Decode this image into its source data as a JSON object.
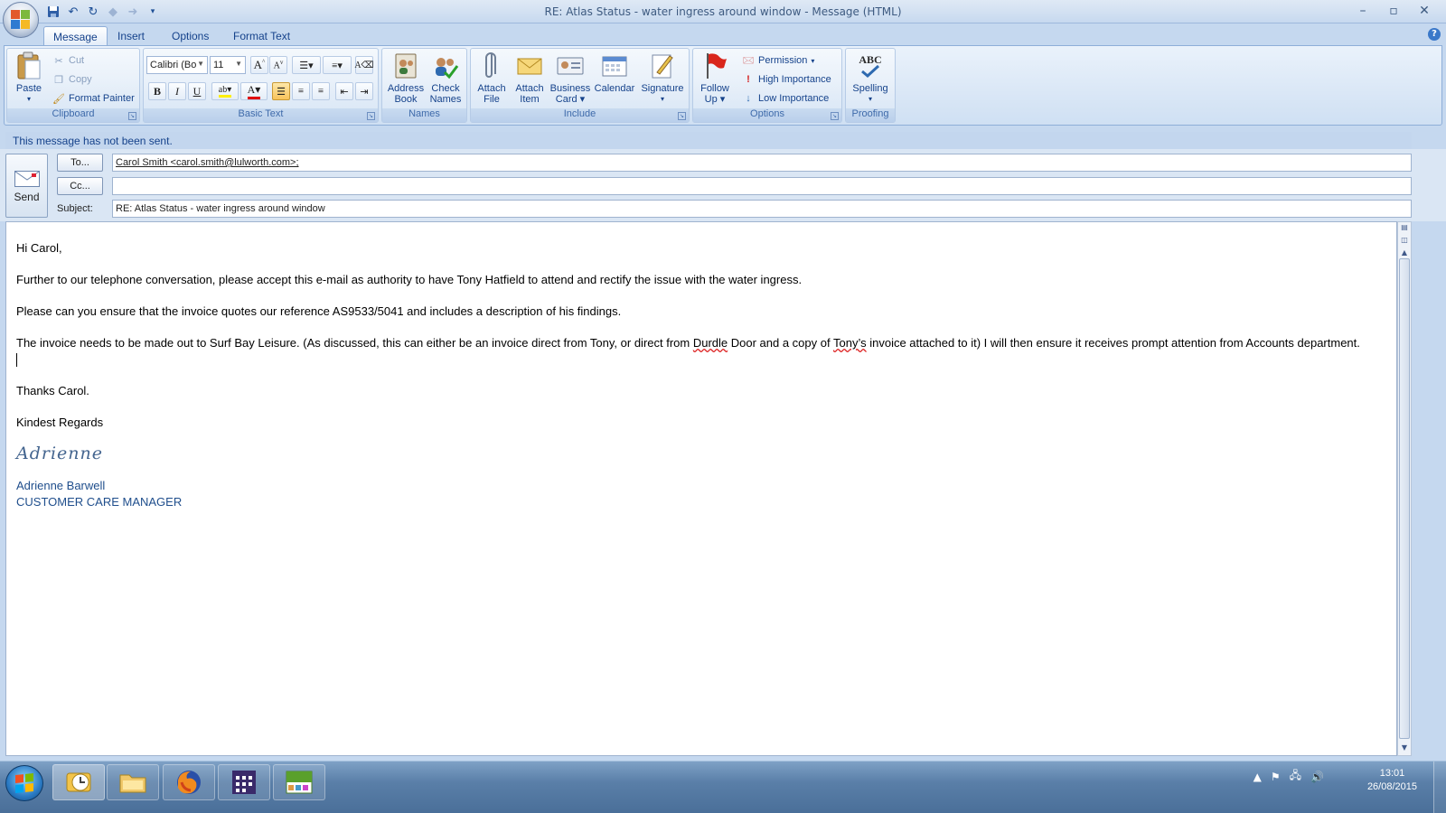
{
  "window": {
    "title": "RE: Atlas Status - water ingress around window - Message (HTML)",
    "minimize": "–",
    "maximize": "▫",
    "close": "✕"
  },
  "tabs": [
    "Message",
    "Insert",
    "Options",
    "Format Text"
  ],
  "ribbon": {
    "clipboard": {
      "label": "Clipboard",
      "paste": "Paste",
      "cut": "Cut",
      "copy": "Copy",
      "format_painter": "Format Painter"
    },
    "basic_text": {
      "label": "Basic Text",
      "font": "Calibri (Bo",
      "size": "11",
      "bold": "B",
      "italic": "I",
      "underline": "U"
    },
    "names": {
      "label": "Names",
      "address_book_1": "Address",
      "address_book_2": "Book",
      "check_names_1": "Check",
      "check_names_2": "Names"
    },
    "include": {
      "label": "Include",
      "attach_file_1": "Attach",
      "attach_file_2": "File",
      "attach_item_1": "Attach",
      "attach_item_2": "Item",
      "business_card_1": "Business",
      "business_card_2": "Card",
      "calendar": "Calendar",
      "signature": "Signature"
    },
    "options": {
      "label": "Options",
      "follow_up_1": "Follow",
      "follow_up_2": "Up",
      "permission": "Permission",
      "high_importance": "High Importance",
      "low_importance": "Low Importance"
    },
    "proofing": {
      "label": "Proofing",
      "spelling": "Spelling",
      "abc": "ABC"
    }
  },
  "compose": {
    "status": "This message has not been sent.",
    "send": "Send",
    "to_button": "To...",
    "cc_button": "Cc...",
    "subject_label": "Subject:",
    "to_value": "Carol Smith <carol.smith@lulworth.com>;",
    "cc_value": "",
    "subject_value": "RE: Atlas Status - water ingress around window"
  },
  "body": {
    "greeting": "Hi Carol,",
    "p1": "Further to our telephone conversation, please accept this e-mail as authority to have Tony Hatfield to attend and rectify the issue with the water ingress.",
    "p2": "Please can you ensure that the invoice quotes our reference AS9533/5041 and includes  a description of his findings.",
    "p3_a": "The invoice  needs to be made out to Surf Bay Leisure. (As discussed, this can either be an invoice direct from Tony, or direct from ",
    "p3_durdle": "Durdle",
    "p3_b": " Door and a copy of ",
    "p3_tonys": "Tony’s",
    "p3_c": " invoice attached to it)  I will then ensure it receives prompt attention from Accounts department.",
    "thanks": "Thanks Carol.",
    "regards": "Kindest Regards",
    "signature_script": "Adrienne",
    "sig_name": "Adrienne Barwell",
    "sig_role": "CUSTOMER CARE MANAGER"
  },
  "taskbar": {
    "time": "13:01",
    "date": "26/08/2015"
  }
}
